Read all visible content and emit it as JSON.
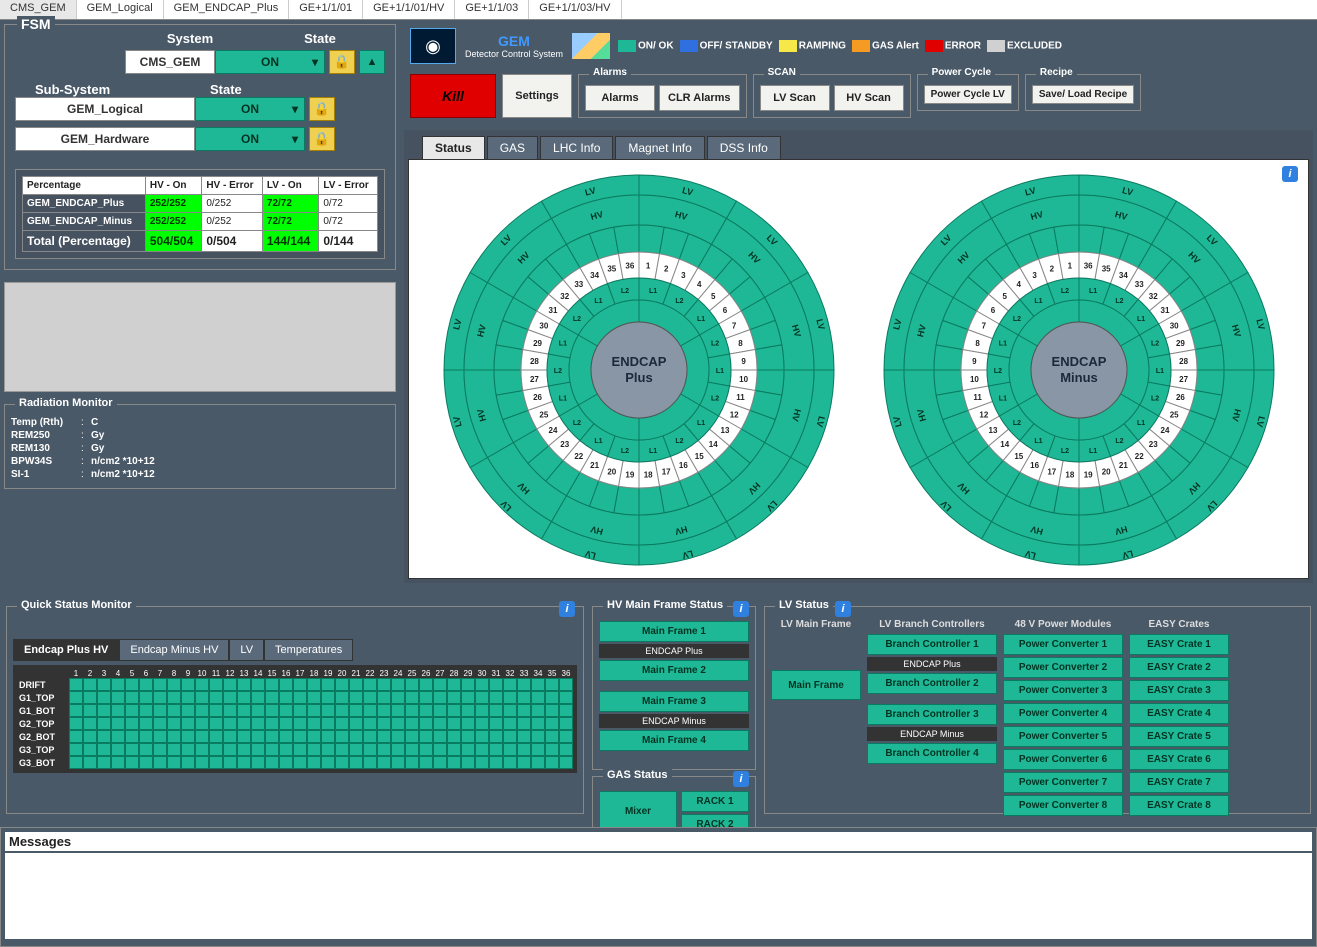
{
  "topTabs": [
    "CMS_GEM",
    "GEM_Logical",
    "GEM_ENDCAP_Plus",
    "GE+1/1/01",
    "GE+1/1/01/HV",
    "GE+1/1/03",
    "GE+1/1/03/HV"
  ],
  "fsm": {
    "title": "FSM",
    "systemLabel": "System",
    "stateLabel": "State",
    "system": "CMS_GEM",
    "systemState": "ON",
    "subSystemLabel": "Sub-System",
    "subStateLabel": "State",
    "subs": [
      {
        "name": "GEM_Logical",
        "state": "ON"
      },
      {
        "name": "GEM_Hardware",
        "state": "ON"
      }
    ]
  },
  "pct": {
    "header": [
      "Percentage",
      "HV - On",
      "HV - Error",
      "LV - On",
      "LV - Error"
    ],
    "rows": [
      {
        "name": "GEM_ENDCAP_Plus",
        "hvon": "252/252",
        "hverr": "0/252",
        "lvon": "72/72",
        "lverr": "0/72"
      },
      {
        "name": "GEM_ENDCAP_Minus",
        "hvon": "252/252",
        "hverr": "0/252",
        "lvon": "72/72",
        "lverr": "0/72"
      }
    ],
    "total": {
      "name": "Total (Percentage)",
      "hvon": "504/504",
      "hverr": "0/504",
      "lvon": "144/144",
      "lverr": "0/144"
    }
  },
  "rad": {
    "title": "Radiation Monitor",
    "rows": [
      {
        "k": "Temp (Rth)",
        "u": "C"
      },
      {
        "k": "REM250",
        "u": "Gy"
      },
      {
        "k": "REM130",
        "u": "Gy"
      },
      {
        "k": "BPW34S",
        "u": "n/cm2 *10+12"
      },
      {
        "k": "SI-1",
        "u": "n/cm2 *10+12"
      }
    ]
  },
  "header": {
    "gem": "GEM",
    "sub": "Detector Control System",
    "legend": [
      {
        "c": "#1fb896",
        "t": "ON/ OK"
      },
      {
        "c": "#2f6fe0",
        "t": "OFF/ STANDBY"
      },
      {
        "c": "#f7e84a",
        "t": "RAMPING"
      },
      {
        "c": "#f59a23",
        "t": "GAS Alert"
      },
      {
        "c": "#e00000",
        "t": "ERROR"
      },
      {
        "c": "#d0d0d0",
        "t": "EXCLUDED"
      }
    ],
    "kill": "Kill",
    "settings": "Settings",
    "alarmsTitle": "Alarms",
    "alarms": "Alarms",
    "clrAlarms": "CLR Alarms",
    "scanTitle": "SCAN",
    "lvScan": "LV Scan",
    "hvScan": "HV Scan",
    "pcTitle": "Power Cycle",
    "pc": "Power Cycle LV",
    "recipeTitle": "Recipe",
    "recipe": "Save/ Load Recipe"
  },
  "statusTabs": [
    "Status",
    "GAS",
    "LHC Info",
    "Magnet Info",
    "DSS Info"
  ],
  "wheels": [
    "ENDCAP\nPlus",
    "ENDCAP\nMinus"
  ],
  "qsm": {
    "title": "Quick Status Monitor",
    "tabs": [
      "Endcap Plus HV",
      "Endcap Minus HV",
      "LV",
      "Temperatures"
    ],
    "rowLabels": [
      "DRIFT",
      "G1_TOP",
      "G1_BOT",
      "G2_TOP",
      "G2_BOT",
      "G3_TOP",
      "G3_BOT"
    ]
  },
  "hvmf": {
    "title": "HV Main Frame Status",
    "frames": [
      "Main Frame 1",
      "Main Frame 2",
      "Main Frame 3",
      "Main Frame 4"
    ],
    "ep": "ENDCAP Plus",
    "em": "ENDCAP Minus"
  },
  "gas": {
    "title": "GAS Status",
    "mixer": "Mixer",
    "racks": [
      "RACK 1",
      "RACK 2"
    ]
  },
  "lv": {
    "title": "LV Status",
    "cols": [
      "LV Main Frame",
      "LV Branch Controllers",
      "48 V Power Modules",
      "EASY Crates"
    ],
    "mf": "Main Frame",
    "ep": "ENDCAP Plus",
    "em": "ENDCAP Minus",
    "bc": [
      "Branch Controller 1",
      "Branch Controller 2",
      "Branch Controller 3",
      "Branch Controller 4"
    ],
    "pc": [
      "Power Converter 1",
      "Power Converter 2",
      "Power Converter 3",
      "Power Converter 4",
      "Power Converter 5",
      "Power Converter 6",
      "Power Converter 7",
      "Power Converter 8"
    ],
    "ec": [
      "EASY Crate 1",
      "EASY Crate 2",
      "EASY Crate 3",
      "EASY Crate 4",
      "EASY Crate 5",
      "EASY Crate 6",
      "EASY Crate 7",
      "EASY Crate 8"
    ]
  },
  "messages": "Messages"
}
